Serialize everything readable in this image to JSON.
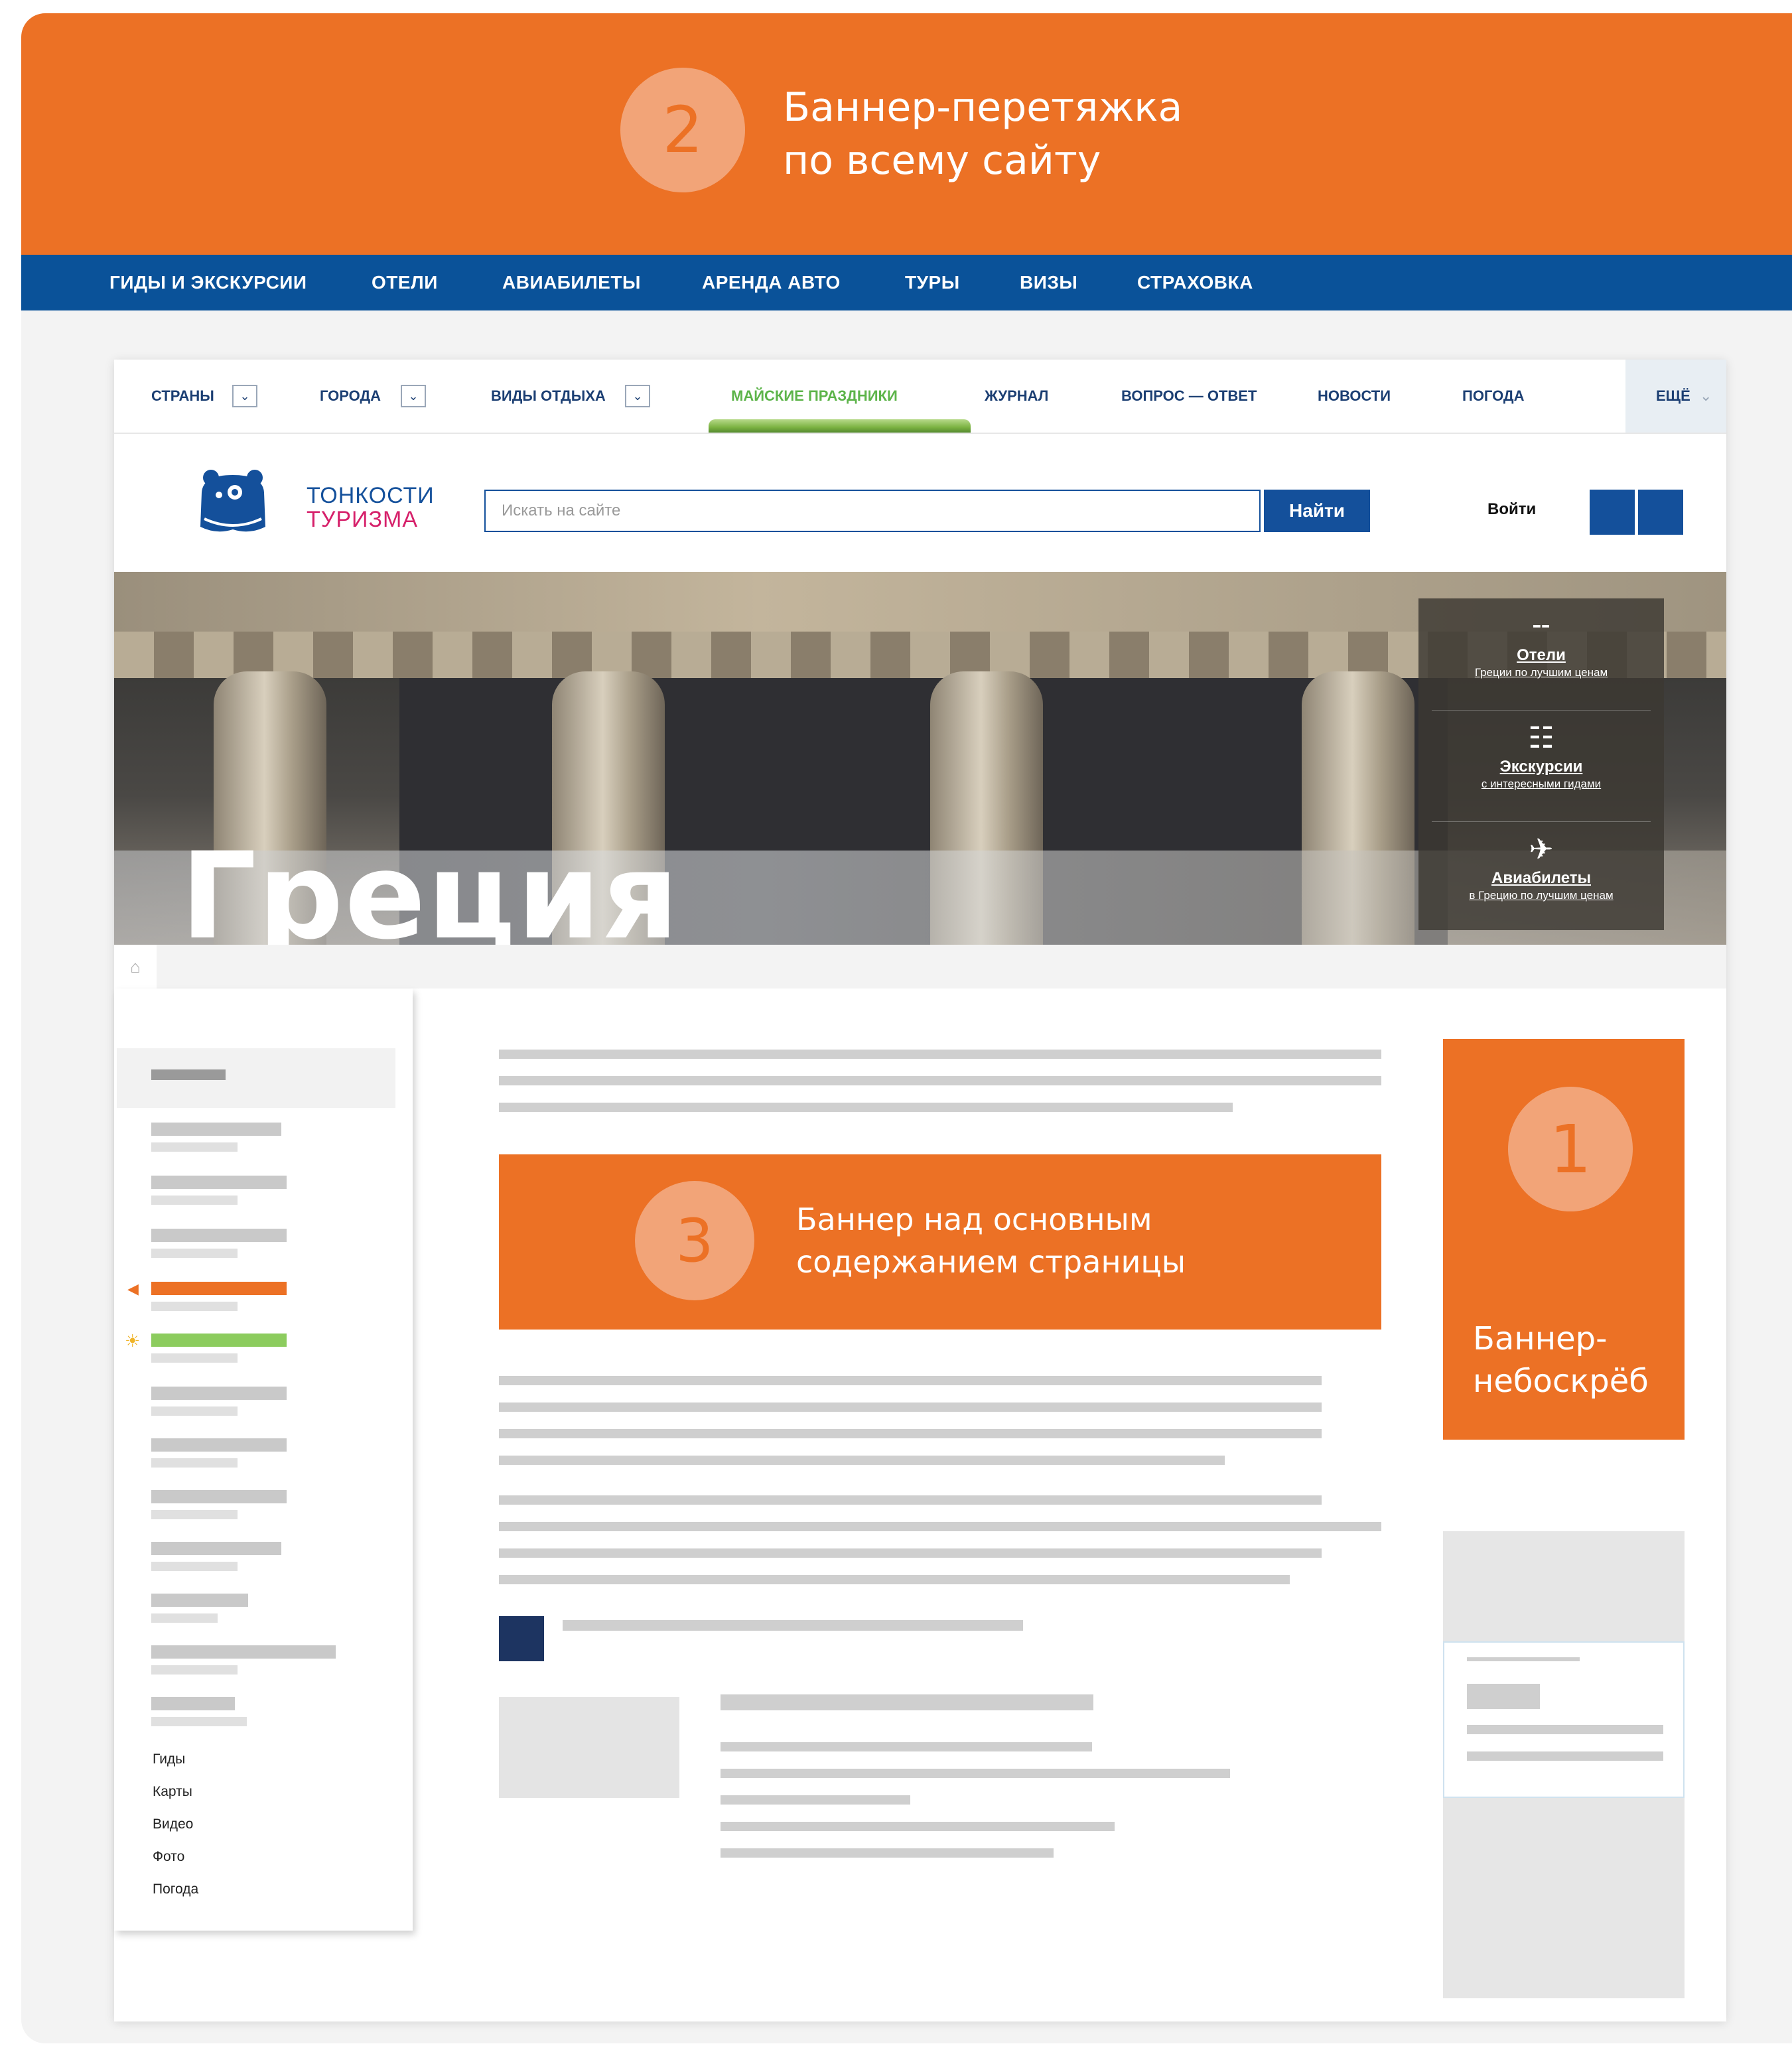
{
  "top_banner": {
    "number": "2",
    "title_line1": "Баннер-перетяжка",
    "title_line2": "по всему сайту"
  },
  "top_nav": [
    "ГИДЫ И ЭКСКУРСИИ",
    "ОТЕЛИ",
    "АВИАБИЛЕТЫ",
    "АРЕНДА АВТО",
    "ТУРЫ",
    "ВИЗЫ",
    "СТРАХОВКА"
  ],
  "site_nav": {
    "countries": "СТРАНЫ",
    "cities": "ГОРОДА",
    "rest_types": "ВИДЫ ОТДЫХА",
    "holidays": "МАЙСКИЕ ПРАЗДНИКИ",
    "journal": "ЖУРНАЛ",
    "qa": "ВОПРОС — ОТВЕТ",
    "news": "НОВОСТИ",
    "weather": "ПОГОДА",
    "more": "ЕЩЁ"
  },
  "header": {
    "logo_line1": "ТОНКОСТИ",
    "logo_line2": "ТУРИЗМА",
    "search_placeholder": "Искать на сайте",
    "search_button": "Найти",
    "login": "Войти"
  },
  "hero": {
    "title": "Греция",
    "menu": [
      {
        "icon": "bed-icon",
        "title": "Отели",
        "subtitle": "Греции по лучшим ценам"
      },
      {
        "icon": "map-icon",
        "title": "Экскурсии",
        "subtitle": "с интересными гидами"
      },
      {
        "icon": "plane-icon",
        "title": "Авиабилеты",
        "subtitle": "в Грецию по лучшим ценам"
      }
    ]
  },
  "sidebar_links": [
    "Гиды",
    "Карты",
    "Видео",
    "Фото",
    "Погода"
  ],
  "banner3": {
    "number": "3",
    "line1": "Баннер над основным",
    "line2": "содержанием страницы"
  },
  "banner1": {
    "number": "1",
    "line1": "Баннер-",
    "line2": "небоскрёб"
  },
  "colors": {
    "accent_orange": "#ec7125",
    "nav_blue": "#0a5299",
    "brand_blue": "#14509b",
    "brand_pink": "#d6206a",
    "holiday_green": "#5db44a"
  }
}
